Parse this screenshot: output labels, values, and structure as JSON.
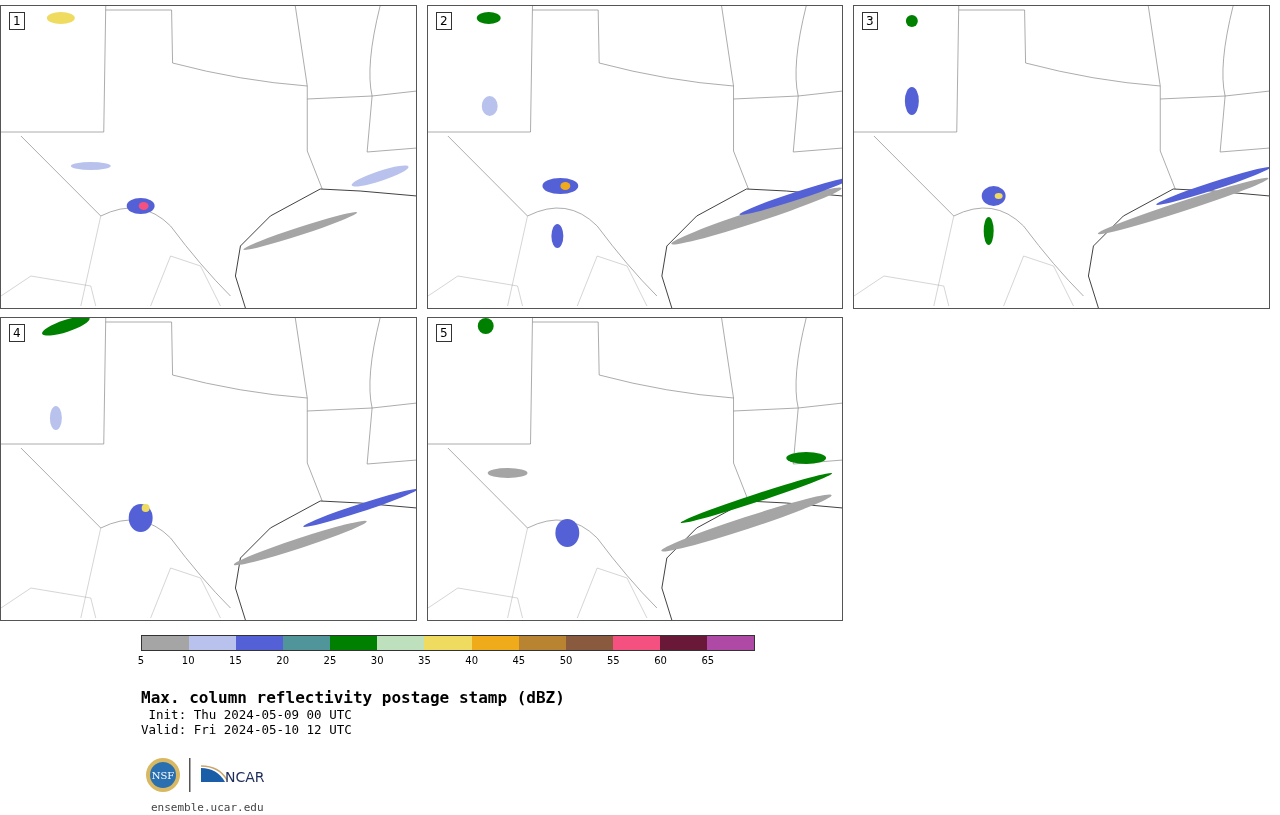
{
  "panels": [
    {
      "label": "1"
    },
    {
      "label": "2"
    },
    {
      "label": "3"
    },
    {
      "label": "4"
    },
    {
      "label": "5"
    }
  ],
  "colorbar": {
    "segments": [
      {
        "color": "#a5a5a5",
        "label": "5"
      },
      {
        "color": "#b8c2ec",
        "label": "10"
      },
      {
        "color": "#5460d6",
        "label": "15"
      },
      {
        "color": "#50959a",
        "label": "20"
      },
      {
        "color": "#008000",
        "label": "25"
      },
      {
        "color": "#bee0bc",
        "label": "30"
      },
      {
        "color": "#eedb5f",
        "label": "35"
      },
      {
        "color": "#f0ab1a",
        "label": "40"
      },
      {
        "color": "#b88432",
        "label": "45"
      },
      {
        "color": "#8a5a3e",
        "label": "50"
      },
      {
        "color": "#f45080",
        "label": "55"
      },
      {
        "color": "#6a1838",
        "label": "60"
      },
      {
        "color": "#ae4aa6",
        "label": "65"
      }
    ]
  },
  "title": "Max. column reflectivity postage stamp (dBZ)",
  "init": " Init: Thu 2024-05-09 00 UTC",
  "valid": "Valid: Fri 2024-05-10 12 UTC",
  "logos": {
    "ncar": "NCAR",
    "nsf": "NSF"
  },
  "url": "ensemble.ucar.edu"
}
